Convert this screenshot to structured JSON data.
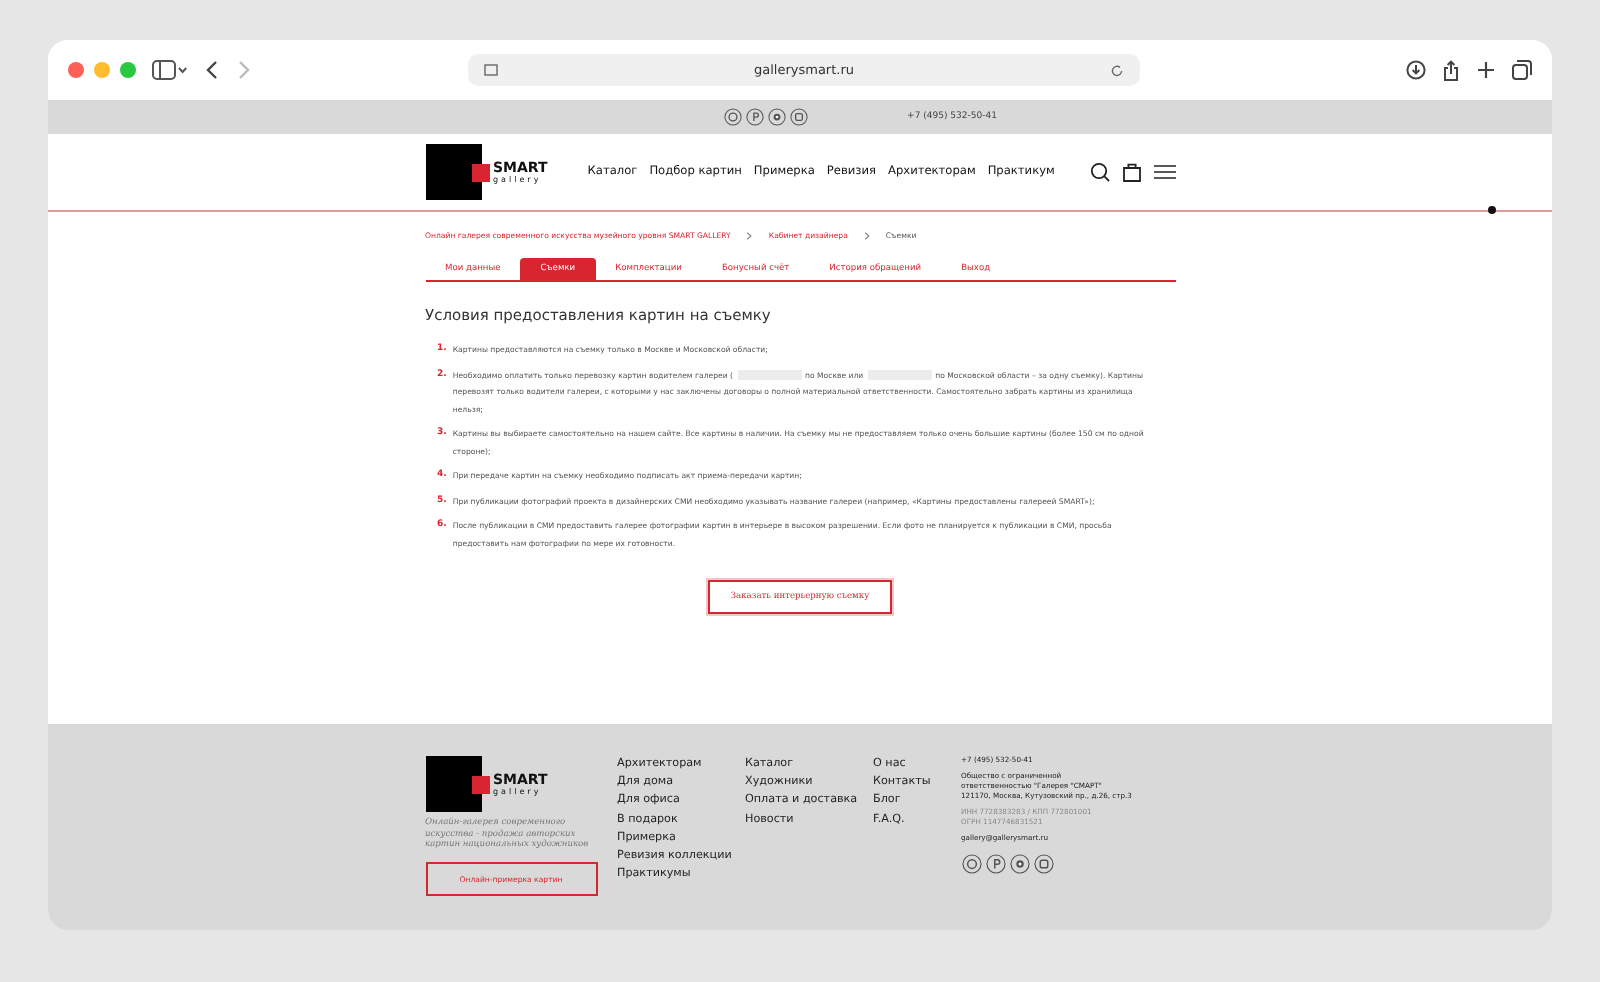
{
  "browser": {
    "url": "gallerysmart.ru"
  },
  "topbar": {
    "phone": "+7 (495) 532-50-41"
  },
  "header": {
    "logo": {
      "title": "SMART",
      "subtitle": "gallery"
    },
    "nav": [
      "Каталог",
      "Подбор картин",
      "Примерка",
      "Ревизия",
      "Архитекторам",
      "Практикум"
    ]
  },
  "breadcrumbs": [
    {
      "label": "Онлайн галерея современного искусства музейного уровня SMART GALLERY",
      "kind": "link"
    },
    {
      "label": "Кабинет дизайнера",
      "kind": "link"
    },
    {
      "label": "Съемки",
      "kind": "current"
    }
  ],
  "tabs": [
    {
      "label": "Мои данные",
      "selected": false
    },
    {
      "label": "Съемки",
      "selected": true
    },
    {
      "label": "Комплектации",
      "selected": false
    },
    {
      "label": "Бонусный счёт",
      "selected": false
    },
    {
      "label": "История обращений",
      "selected": false
    },
    {
      "label": "Выход",
      "selected": false
    }
  ],
  "heading": "Условия предоставления картин на съемку",
  "conditions": [
    {
      "number": "1.",
      "parts": [
        "Картины предоставляются на съемку только в Москве и Московской области;"
      ]
    },
    {
      "number": "2.",
      "parts": [
        "Необходимо оплатить только перевозку картин водителем галереи (",
        "по Москве или",
        "по Московской области – за одну съемку). Картины перевозят только водители галереи, с которыми у нас заключены договоры о полной материальной ответственности. Самостоятельно забрать картины из хранилища нельзя;"
      ]
    },
    {
      "number": "3.",
      "parts": [
        "Картины вы выбираете самостоятельно на нашем сайте. Все картины в наличии. На съемку мы не предоставляем только очень большие картины (более 150 см по одной стороне);"
      ]
    },
    {
      "number": "4.",
      "parts": [
        "При передаче картин на съемку необходимо подписать акт приема-передачи картин;"
      ]
    },
    {
      "number": "5.",
      "parts": [
        "При публикации фотографий проекта в дизайнерских СМИ необходимо указывать название галереи (например, «Картины предоставлены галереей SMART»);"
      ]
    },
    {
      "number": "6.",
      "parts": [
        "После публикации в СМИ предоставить галерее фотографии картин в интерьере в высоком разрешении. Если фото не планируется к публикации в СМИ, просьба предоставить нам фотографии по мере их готовности."
      ]
    }
  ],
  "order_button": "Заказать интерьерную съемку",
  "footer": {
    "logo": {
      "title": "SMART",
      "subtitle": "gallery"
    },
    "tagline": "Онлайн-галерея современного искусства - продажа авторских картин национальных художников",
    "fitting_button": "Онлайн-примерка картин",
    "columns": [
      [
        "Архитекторам",
        "Для дома",
        "Для офиса",
        "В подарок",
        "Примерка",
        "Ревизия коллекции",
        "Практикумы"
      ],
      [
        "Каталог",
        "Художники",
        "Оплата и доставка",
        "Новости"
      ],
      [
        "О нас",
        "Контакты",
        "Блог",
        "F.A.Q."
      ]
    ],
    "contacts": [
      {
        "text": "+7 (495) 532-50-41",
        "kind": "phone"
      },
      {
        "text": "Общество с ограниченной ответственностью \"Галерея \"СМАРТ\"\n121170, Москва, Кутузовский пр., д.26, стр.3",
        "kind": "address"
      },
      {
        "text": "ИНН 7728383283 / КПП 772801001\nОГРН 1147746831521",
        "kind": "legal"
      },
      {
        "text": "gallery@gallerysmart.ru",
        "kind": "email"
      }
    ]
  }
}
